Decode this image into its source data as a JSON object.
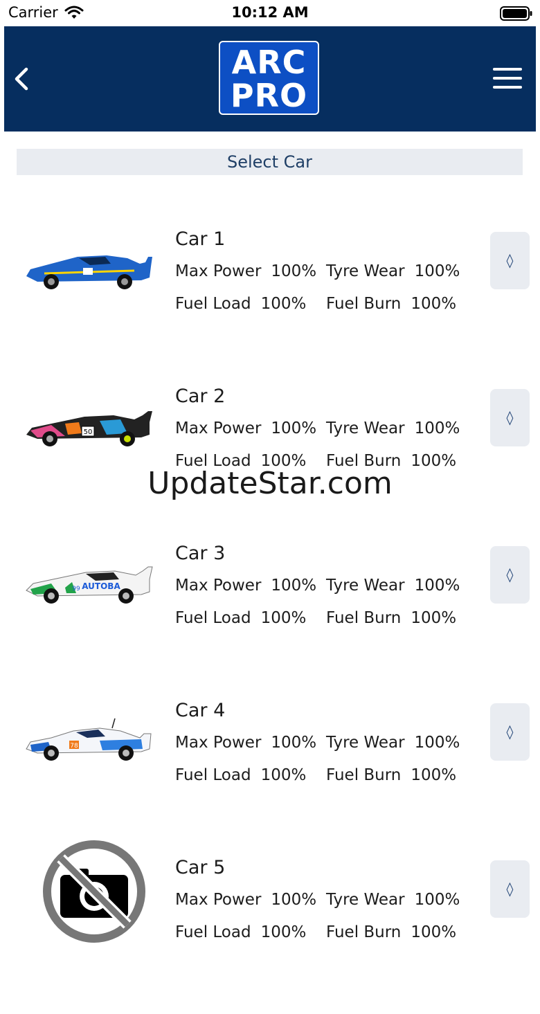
{
  "status_bar": {
    "carrier": "Carrier",
    "time": "10:12 AM",
    "wifi_icon": "wifi-icon",
    "battery_icon": "battery-icon"
  },
  "nav": {
    "back_icon": "chevron-left-icon",
    "logo_line1": "ARC",
    "logo_line2": "PRO",
    "menu_icon": "hamburger-menu-icon",
    "background_color": "#062e5f",
    "logo_color": "#0d4fc4"
  },
  "section_header": "Select Car",
  "cars": [
    {
      "name": "Car 1",
      "max_power_label": "Max Power",
      "max_power": "100%",
      "tyre_wear_label": "Tyre Wear",
      "tyre_wear": "100%",
      "fuel_load_label": "Fuel Load",
      "fuel_load": "100%",
      "fuel_burn_label": "Fuel Burn",
      "fuel_burn": "100%",
      "image": "blue-gt-car",
      "button_glyph": "◊"
    },
    {
      "name": "Car 2",
      "max_power_label": "Max Power",
      "max_power": "100%",
      "tyre_wear_label": "Tyre Wear",
      "tyre_wear": "100%",
      "fuel_load_label": "Fuel Load",
      "fuel_load": "100%",
      "fuel_burn_label": "Fuel Burn",
      "fuel_burn": "100%",
      "image": "art-livery-car",
      "car_number": "50",
      "button_glyph": "◊"
    },
    {
      "name": "Car 3",
      "max_power_label": "Max Power",
      "max_power": "100%",
      "tyre_wear_label": "Tyre Wear",
      "tyre_wear": "100%",
      "fuel_load_label": "Fuel Load",
      "fuel_load": "100%",
      "fuel_burn_label": "Fuel Burn",
      "fuel_burn": "100%",
      "image": "white-green-car",
      "car_number": "99",
      "car_sponsor": "AUTOBA",
      "button_glyph": "◊"
    },
    {
      "name": "Car 4",
      "max_power_label": "Max Power",
      "max_power": "100%",
      "tyre_wear_label": "Tyre Wear",
      "tyre_wear": "100%",
      "fuel_load_label": "Fuel Load",
      "fuel_load": "100%",
      "fuel_burn_label": "Fuel Burn",
      "fuel_burn": "100%",
      "image": "white-blue-porsche",
      "car_number": "78",
      "button_glyph": "◊"
    },
    {
      "name": "Car 5",
      "max_power_label": "Max Power",
      "max_power": "100%",
      "tyre_wear_label": "Tyre Wear",
      "tyre_wear": "100%",
      "fuel_load_label": "Fuel Load",
      "fuel_load": "100%",
      "fuel_burn_label": "Fuel Burn",
      "fuel_burn": "100%",
      "image": "no-photo-icon",
      "button_glyph": "◊"
    }
  ],
  "watermark": "UpdateStar.com"
}
